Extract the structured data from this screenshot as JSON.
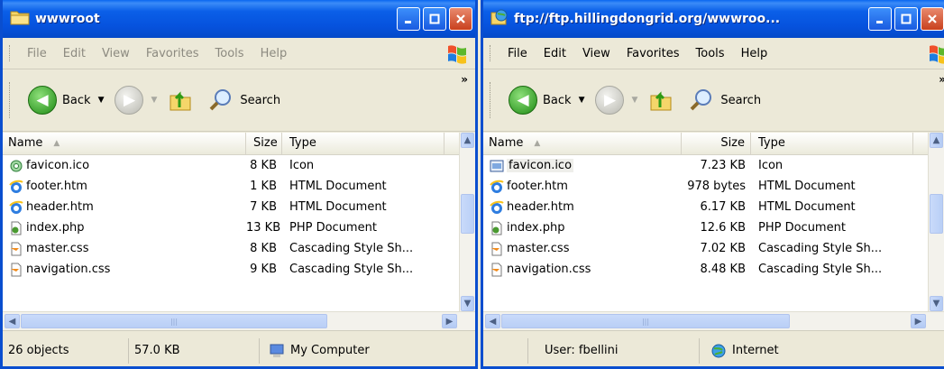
{
  "left": {
    "title": "wwwroot",
    "menu": [
      "File",
      "Edit",
      "View",
      "Favorites",
      "Tools",
      "Help"
    ],
    "toolbar": {
      "back_label": "Back",
      "search_label": "Search"
    },
    "columns": {
      "name": "Name",
      "size": "Size",
      "type": "Type"
    },
    "files": [
      {
        "name": "favicon.ico",
        "size": "8 KB",
        "type": "Icon",
        "icon": "icon-file-icon"
      },
      {
        "name": "footer.htm",
        "size": "1 KB",
        "type": "HTML Document",
        "icon": "ie-html-icon"
      },
      {
        "name": "header.htm",
        "size": "7 KB",
        "type": "HTML Document",
        "icon": "ie-html-icon"
      },
      {
        "name": "index.php",
        "size": "13 KB",
        "type": "PHP Document",
        "icon": "php-file-icon"
      },
      {
        "name": "master.css",
        "size": "8 KB",
        "type": "Cascading Style Sh...",
        "icon": "css-file-icon"
      },
      {
        "name": "navigation.css",
        "size": "9 KB",
        "type": "Cascading Style Sh...",
        "icon": "css-file-icon"
      }
    ],
    "status": {
      "count": "26 objects",
      "total": "57.0 KB",
      "zone": "My Computer"
    }
  },
  "right": {
    "title": "ftp://ftp.hillingdongrid.org/wwwroo...",
    "menu": [
      "File",
      "Edit",
      "View",
      "Favorites",
      "Tools",
      "Help"
    ],
    "toolbar": {
      "back_label": "Back",
      "search_label": "Search"
    },
    "columns": {
      "name": "Name",
      "size": "Size",
      "type": "Type"
    },
    "files": [
      {
        "name": "favicon.ico",
        "size": "7.23 KB",
        "type": "Icon",
        "icon": "icon-file-icon"
      },
      {
        "name": "footer.htm",
        "size": "978 bytes",
        "type": "HTML Document",
        "icon": "ie-html-icon"
      },
      {
        "name": "header.htm",
        "size": "6.17 KB",
        "type": "HTML Document",
        "icon": "ie-html-icon"
      },
      {
        "name": "index.php",
        "size": "12.6 KB",
        "type": "PHP Document",
        "icon": "php-file-icon"
      },
      {
        "name": "master.css",
        "size": "7.02 KB",
        "type": "Cascading Style Sh...",
        "icon": "css-file-icon"
      },
      {
        "name": "navigation.css",
        "size": "8.48 KB",
        "type": "Cascading Style Sh...",
        "icon": "css-file-icon"
      }
    ],
    "status": {
      "user": "User: fbellini",
      "zone": "Internet"
    }
  },
  "colors": {
    "title_blue": "#0A5FE8",
    "close_red": "#C9401E",
    "chrome": "#ECE9D8",
    "scroll_blue": "#C9DAFA"
  }
}
